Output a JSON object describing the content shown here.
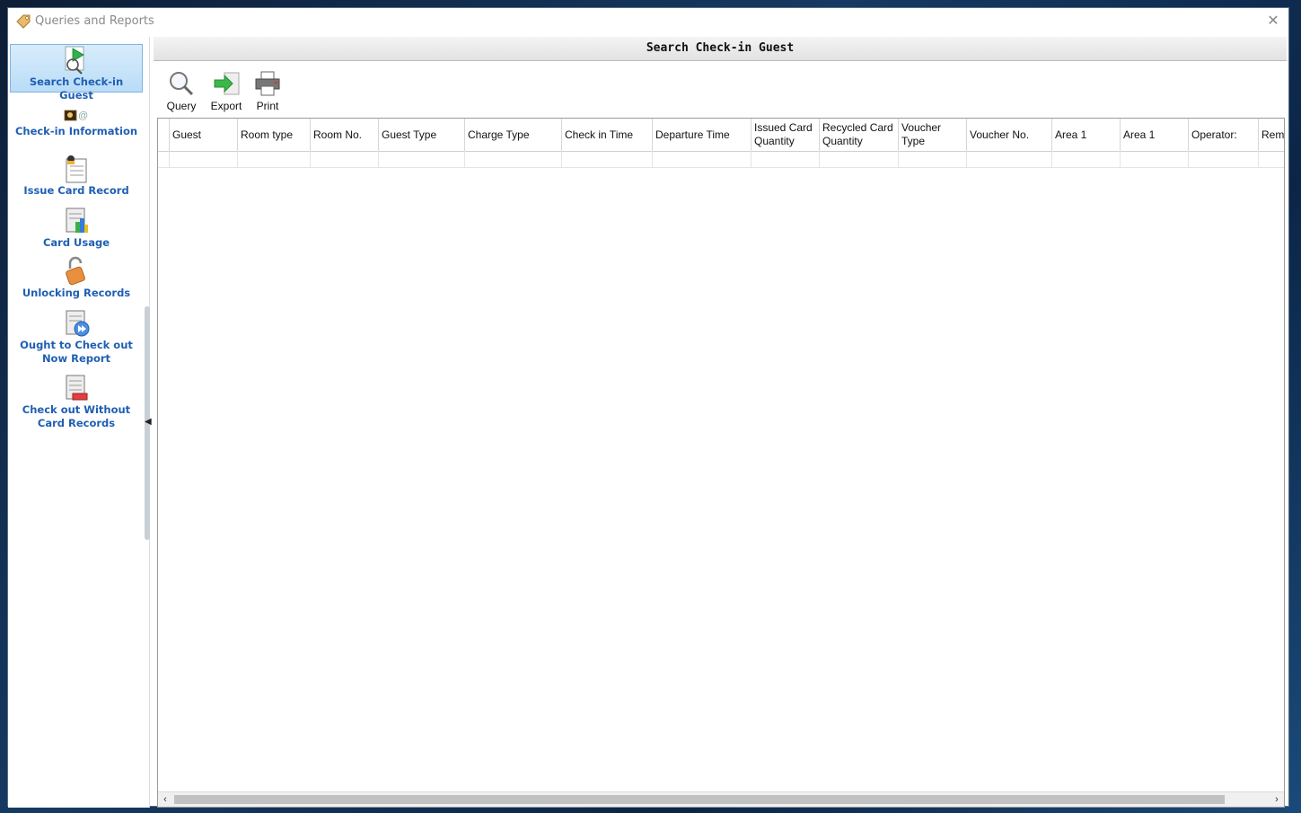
{
  "window": {
    "title": "Queries and Reports",
    "close_symbol": "✕"
  },
  "nav": {
    "items": [
      {
        "label": "Search Check-in Guest",
        "active": true
      },
      {
        "label": "Check-in Information"
      },
      {
        "label": "Issue Card Record"
      },
      {
        "label": "Card Usage"
      },
      {
        "label": "Unlocking Records"
      },
      {
        "label": "Ought to Check out Now Report"
      },
      {
        "label": "Check out Without Card Records"
      }
    ]
  },
  "panel": {
    "title": "Search Check-in Guest"
  },
  "toolbar": {
    "query": "Query",
    "export": "Export",
    "print": "Print"
  },
  "table": {
    "columns": [
      "Guest",
      "Room type",
      "Room No.",
      "Guest Type",
      "Charge Type",
      "Check in Time",
      "Departure Time",
      "Issued Card\nQuantity",
      "Recycled Card\nQuantity",
      "Voucher\nType",
      "Voucher No.",
      "Area 1",
      "Area 1",
      "Operator:",
      "Rem"
    ]
  },
  "scrollbar": {
    "left_arrow": "‹",
    "right_arrow": "›"
  }
}
